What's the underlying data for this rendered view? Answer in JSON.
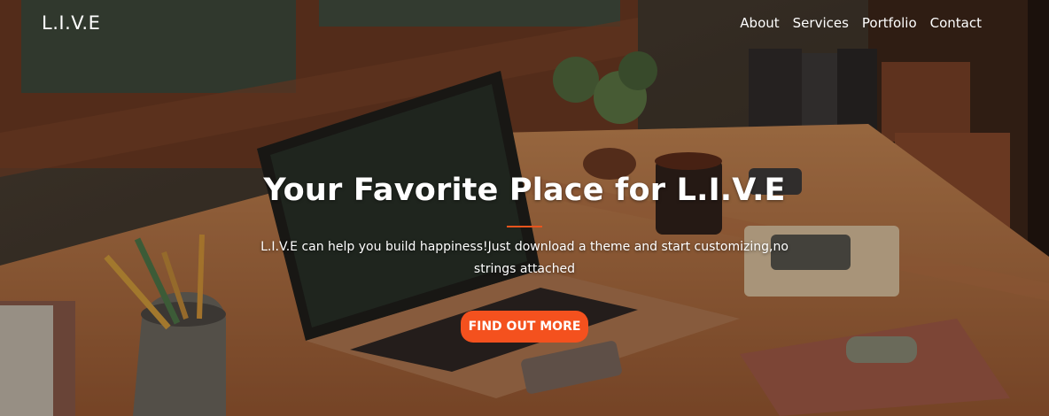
{
  "brand": {
    "name": "L.I.V.E"
  },
  "nav": {
    "items": [
      {
        "label": "About"
      },
      {
        "label": "Services"
      },
      {
        "label": "Portfolio"
      },
      {
        "label": "Contact"
      }
    ]
  },
  "hero": {
    "title": "Your Favorite Place for L.I.V.E",
    "subtitle": "L.I.V.E can help you build happiness!Just download a theme and start customizing,no strings attached",
    "cta_label": "FIND OUT MORE"
  },
  "colors": {
    "accent": "#f4511e",
    "divider": "#e8541d",
    "text": "#ffffff"
  }
}
